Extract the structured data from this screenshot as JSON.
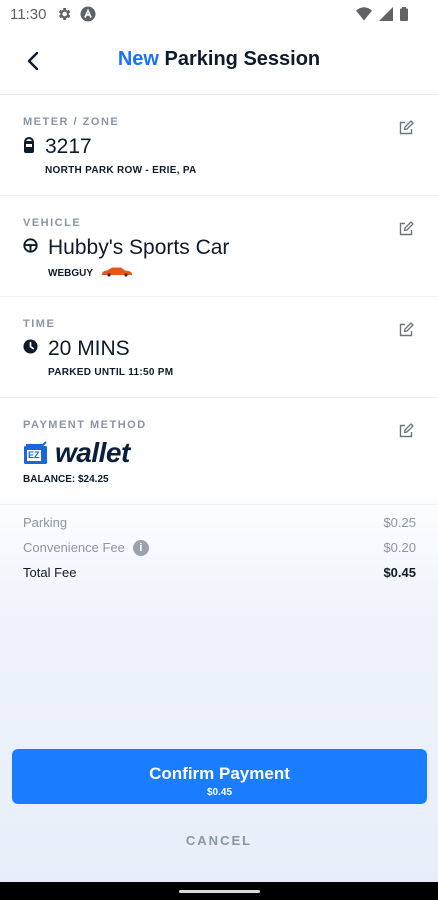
{
  "status_bar": {
    "time": "11:30"
  },
  "header": {
    "title_new": "New",
    "title_rest": "Parking Session"
  },
  "meter": {
    "label": "METER / ZONE",
    "number": "3217",
    "location": "NORTH PARK ROW - ERIE, PA"
  },
  "vehicle": {
    "label": "VEHICLE",
    "name": "Hubby's Sports Car",
    "plate": "WEBGUY"
  },
  "time": {
    "label": "TIME",
    "duration": "20 MINS",
    "parked_until": "PARKED UNTIL 11:50 PM"
  },
  "payment": {
    "label": "PAYMENT METHOD",
    "wallet_text": "wallet",
    "wallet_badge": "EZ",
    "balance": "BALANCE: $24.25"
  },
  "fees": {
    "rows": [
      {
        "label": "Parking",
        "amount": "$0.25"
      },
      {
        "label": "Convenience Fee",
        "amount": "$0.20"
      },
      {
        "label": "Total Fee",
        "amount": "$0.45"
      }
    ],
    "info_glyph": "i"
  },
  "actions": {
    "confirm_label": "Confirm Payment",
    "confirm_amount": "$0.45",
    "cancel_label": "CANCEL"
  },
  "colors": {
    "accent": "#1a7cff",
    "text": "#0d1b2a",
    "muted": "#8b95a3",
    "car": "#e8541a"
  }
}
